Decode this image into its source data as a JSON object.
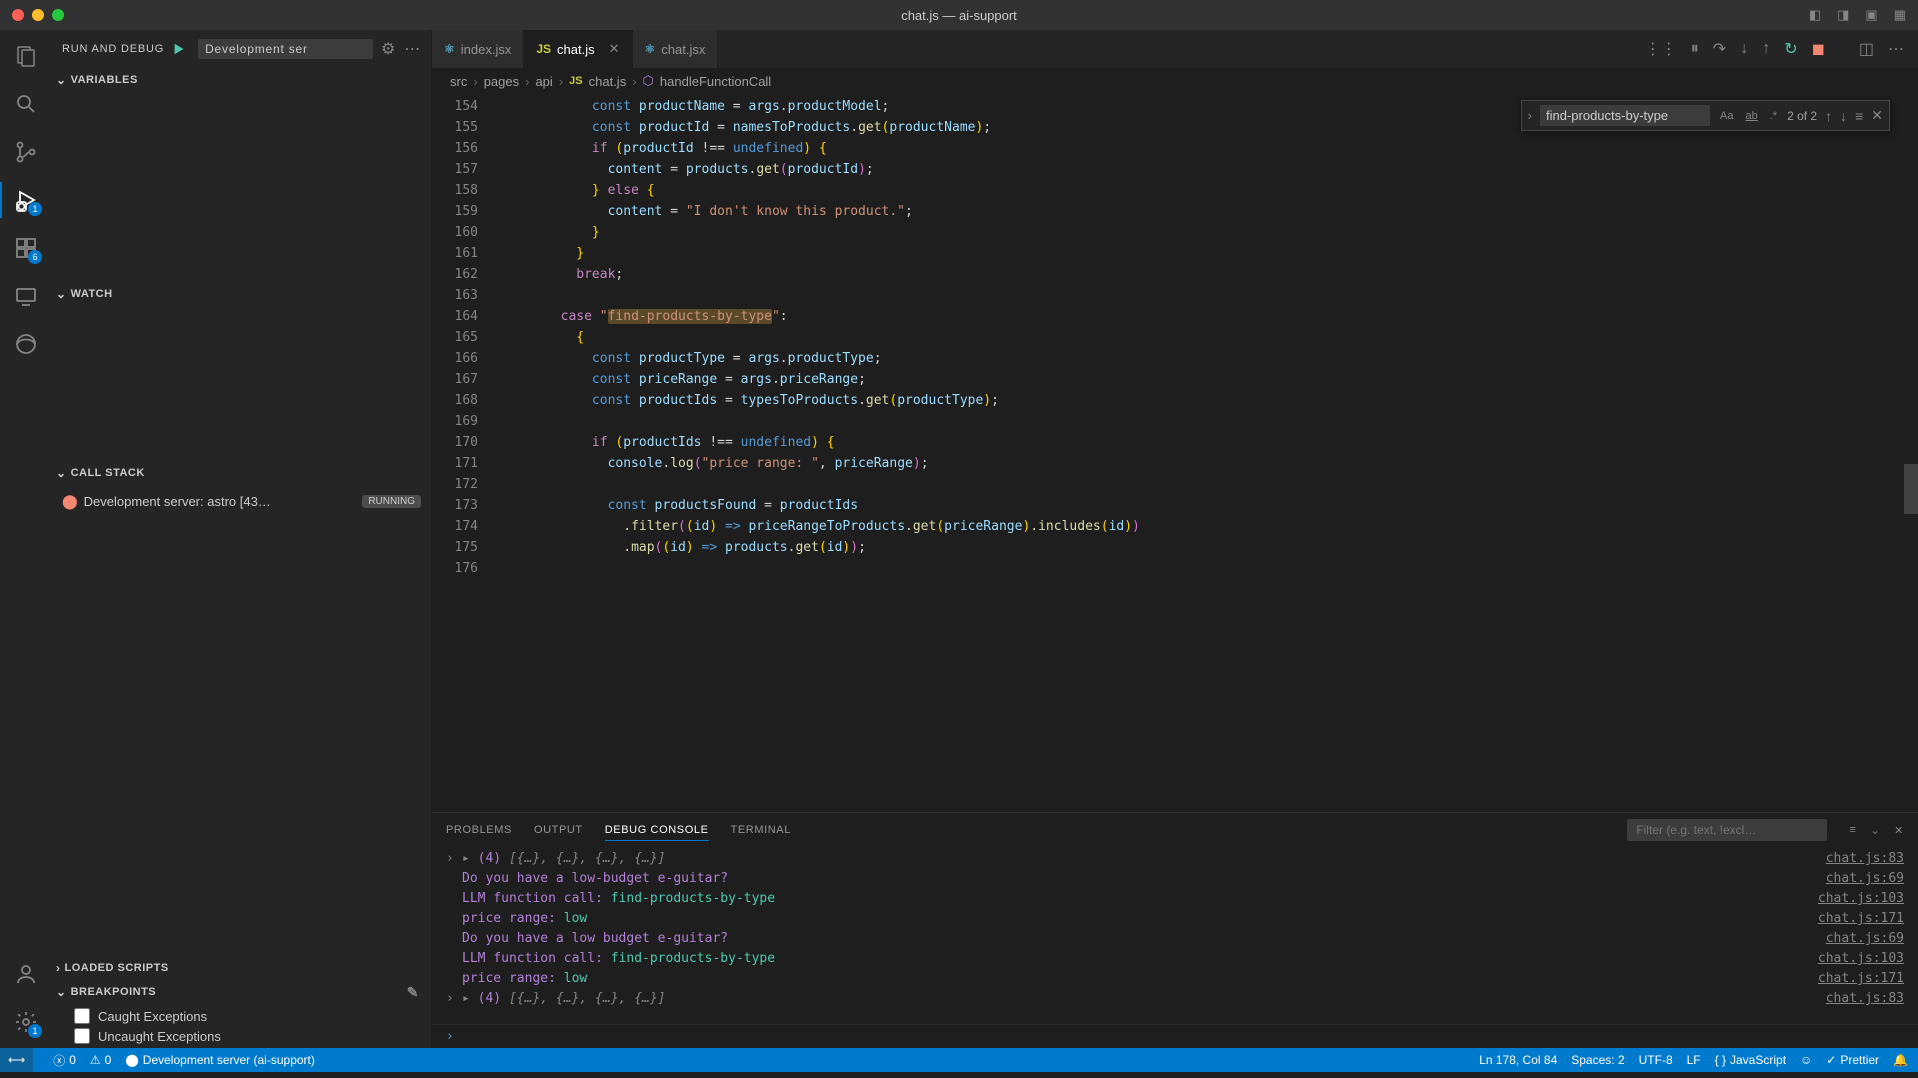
{
  "window": {
    "title": "chat.js — ai-support"
  },
  "activity": {
    "debug_badge": "1",
    "ext_badge": "6",
    "settings_badge": "1"
  },
  "sidebar": {
    "title": "RUN AND DEBUG",
    "config": "Development ser",
    "sections": {
      "variables": "VARIABLES",
      "watch": "WATCH",
      "callstack": "CALL STACK",
      "loaded": "LOADED SCRIPTS",
      "breakpoints": "BREAKPOINTS"
    },
    "callstack_item": {
      "label": "Development server: astro [43…",
      "status": "RUNNING"
    },
    "breakpoints": {
      "caught": "Caught Exceptions",
      "uncaught": "Uncaught Exceptions"
    }
  },
  "tabs": [
    {
      "icon": "jsx",
      "label": "index.jsx"
    },
    {
      "icon": "js",
      "label": "chat.js",
      "active": true
    },
    {
      "icon": "jsx",
      "label": "chat.jsx"
    }
  ],
  "breadcrumb": {
    "parts": [
      "src",
      "pages",
      "api",
      "chat.js",
      "handleFunctionCall"
    ]
  },
  "find": {
    "value": "find-products-by-type",
    "count": "2 of 2"
  },
  "gutter": [
    "154",
    "155",
    "156",
    "157",
    "158",
    "159",
    "160",
    "161",
    "162",
    "163",
    "164",
    "165",
    "166",
    "167",
    "168",
    "169",
    "170",
    "171",
    "172",
    "173",
    "174",
    "175",
    "176"
  ],
  "panel": {
    "tabs": {
      "problems": "Problems",
      "output": "Output",
      "debug": "Debug Console",
      "terminal": "Terminal"
    },
    "filter_placeholder": "Filter (e.g. text, !excl…"
  },
  "console": {
    "line1_prefix": "(4)",
    "line1_body": "[{…}, {…}, {…}, {…}]",
    "line1_loc": "chat.js:83",
    "line2": "Do you have a low-budget e-guitar?",
    "line2_loc": "chat.js:69",
    "line3a": "LLM function call:  ",
    "line3b": "find-products-by-type",
    "line3_loc": "chat.js:103",
    "line4a": "price range:  ",
    "line4b": "low",
    "line4_loc": "chat.js:171",
    "line5": "Do you have a low budget e-guitar?",
    "line5_loc": "chat.js:69",
    "line6a": "LLM function call:  ",
    "line6b": "find-products-by-type",
    "line6_loc": "chat.js:103",
    "line7a": "price range:  ",
    "line7b": "low",
    "line7_loc": "chat.js:171",
    "line8_prefix": "(4)",
    "line8_body": "[{…}, {…}, {…}, {…}]",
    "line8_loc": "chat.js:83"
  },
  "status": {
    "errors": "0",
    "warnings": "0",
    "server": "Development server (ai-support)",
    "cursor": "Ln 178, Col 84",
    "spaces": "Spaces: 2",
    "encoding": "UTF-8",
    "eol": "LF",
    "lang": "JavaScript",
    "prettier": "Prettier"
  }
}
